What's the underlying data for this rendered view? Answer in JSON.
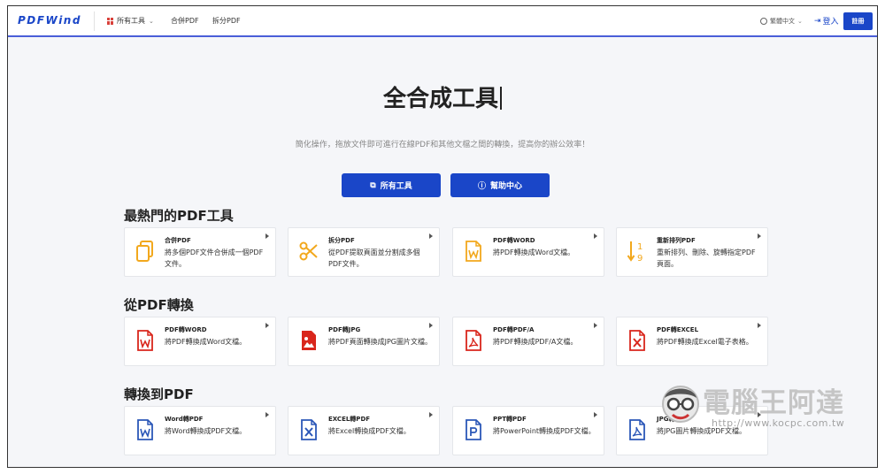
{
  "header": {
    "logo": "PDFWind",
    "nav": [
      {
        "label": "所有工具"
      },
      {
        "label": "合併PDF"
      },
      {
        "label": "拆分PDF"
      }
    ],
    "language": "繁體中文",
    "login_label": "登入",
    "signup_label": "註冊"
  },
  "hero": {
    "title": "全合成工具",
    "subtitle": "簡化操作，拖放文件即可進行在線PDF和其他文檔之間的轉換，提高你的辦公效率！",
    "btn_tools": "所有工具",
    "btn_help": "幫助中心"
  },
  "sections": [
    {
      "title": "最熱門的PDF工具",
      "cards": [
        {
          "name": "合併PDF",
          "desc": "將多個PDF文件合併成一個PDF文件。",
          "icon": "merge-icon",
          "color": "#f2a81d"
        },
        {
          "name": "拆分PDF",
          "desc": "從PDF提取頁面並分割成多個PDF文件。",
          "icon": "scissors-icon",
          "color": "#f2a81d"
        },
        {
          "name": "PDF轉WORD",
          "desc": "將PDF轉換成Word文檔。",
          "icon": "word-file-icon",
          "color": "#f2a81d"
        },
        {
          "name": "重新排列PDF",
          "desc": "重新排列、刪除、旋轉指定PDF頁面。",
          "icon": "sort-icon",
          "color": "#f2a81d"
        }
      ]
    },
    {
      "title": "從PDF轉換",
      "cards": [
        {
          "name": "PDF轉WORD",
          "desc": "將PDF轉換成Word文檔。",
          "icon": "word-file-icon",
          "color": "#d9261c"
        },
        {
          "name": "PDF轉JPG",
          "desc": "將PDF頁面轉換成JPG圖片文檔。",
          "icon": "image-file-icon",
          "color": "#d9261c"
        },
        {
          "name": "PDF轉PDF/A",
          "desc": "將PDF轉換成PDF/A文檔。",
          "icon": "pdf-file-icon",
          "color": "#d9261c"
        },
        {
          "name": "PDF轉EXCEL",
          "desc": "將PDF轉換成Excel電子表格。",
          "icon": "excel-file-icon",
          "color": "#d9261c"
        }
      ]
    },
    {
      "title": "轉換到PDF",
      "cards": [
        {
          "name": "Word轉PDF",
          "desc": "將Word轉換成PDF文檔。",
          "icon": "word-file-icon",
          "color": "#2b57b8"
        },
        {
          "name": "EXCEL轉PDF",
          "desc": "將Excel轉換成PDF文檔。",
          "icon": "excel-file-icon",
          "color": "#2b57b8"
        },
        {
          "name": "PPT轉PDF",
          "desc": "將PowerPoint轉換成PDF文檔。",
          "icon": "ppt-file-icon",
          "color": "#2b57b8"
        },
        {
          "name": "JPG轉PDF",
          "desc": "將JPG圖片轉換成PDF文檔。",
          "icon": "pdf-file-icon",
          "color": "#2b57b8"
        }
      ]
    }
  ],
  "watermark": {
    "brand": "電腦王阿達",
    "url": "http://www.kocpc.com.tw"
  },
  "colors": {
    "accent": "#1a46c8",
    "popular": "#f2a81d",
    "from_pdf": "#d9261c",
    "to_pdf": "#2b57b8"
  }
}
